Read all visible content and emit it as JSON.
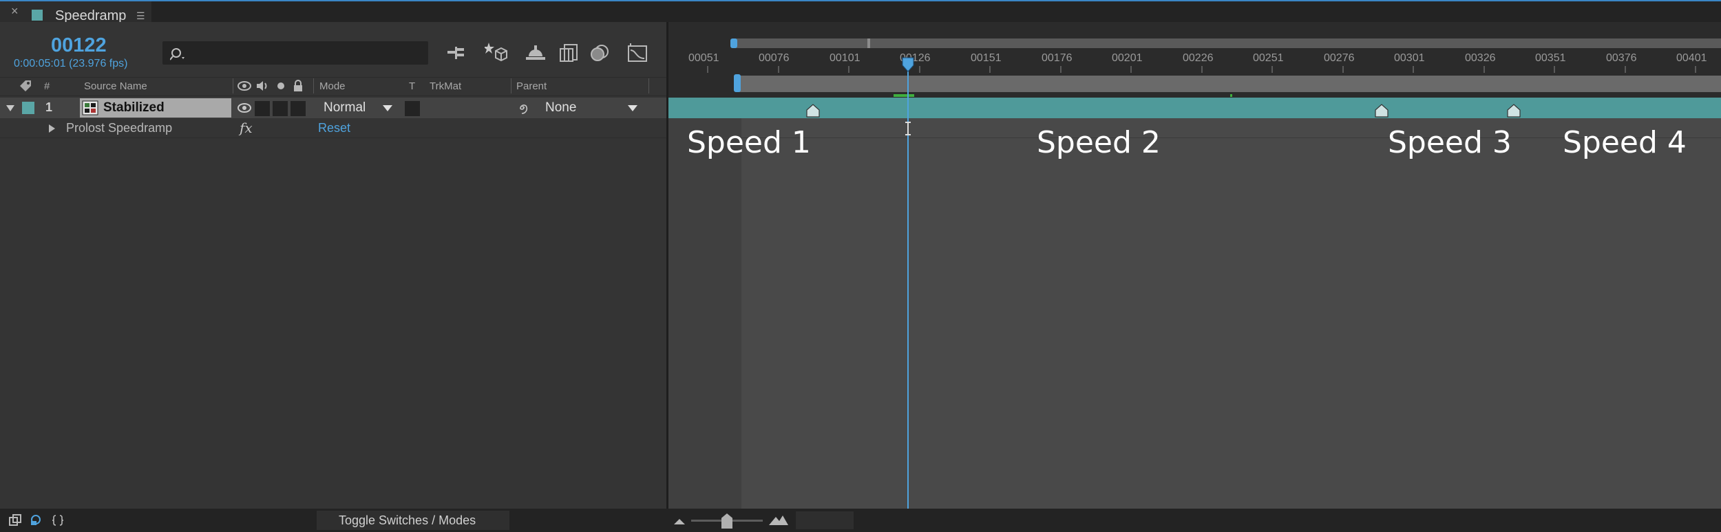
{
  "panel": {
    "close": "×",
    "title": "Speedramp",
    "menu": "☰"
  },
  "timecode": {
    "frame": "00122",
    "time": "0:00:05:01 (23.976 fps)"
  },
  "search": {
    "placeholder": ""
  },
  "columns": {
    "number": "#",
    "source_name": "Source Name",
    "mode": "Mode",
    "t": "T",
    "trkmat": "TrkMat",
    "parent": "Parent"
  },
  "layer": {
    "index": "1",
    "name": "Stabilized",
    "mode": "Normal",
    "parent": "None",
    "label_color": "#5aa6a6"
  },
  "effect": {
    "name": "Prolost Speedramp",
    "fx": "fx",
    "reset": "Reset"
  },
  "ruler": {
    "ticks": [
      "00051",
      "00076",
      "00101",
      "00126",
      "00151",
      "00176",
      "00201",
      "00226",
      "00251",
      "00276",
      "00301",
      "00326",
      "00351",
      "00376",
      "00401"
    ],
    "playhead_frame": "00122"
  },
  "annotations": [
    "Speed 1",
    "Speed 2",
    "Speed 3",
    "Speed 4"
  ],
  "bottom": {
    "toggle_label": "Toggle Switches / Modes"
  },
  "colors": {
    "accent": "#4fa3de",
    "layer_bar": "#4f9a9a",
    "panel": "#343434",
    "work_area": "#6a6a6a"
  },
  "icons": [
    "composition-icon",
    "search-icon",
    "shy-layers-icon",
    "draft-3d-icon",
    "motion-blur-icon",
    "frame-blending-icon",
    "graph-editor-icon",
    "label-tag-icon",
    "video-eye-icon",
    "audio-speaker-icon",
    "solo-icon",
    "lock-icon",
    "expand-triangle-icon",
    "spiral-pickwhip-icon",
    "dropdown-arrow-icon",
    "layer-thumbnail-icon",
    "keyframe-marker-icon",
    "playhead-icon",
    "zoom-out-mountain-icon",
    "zoom-in-mountain-icon"
  ]
}
